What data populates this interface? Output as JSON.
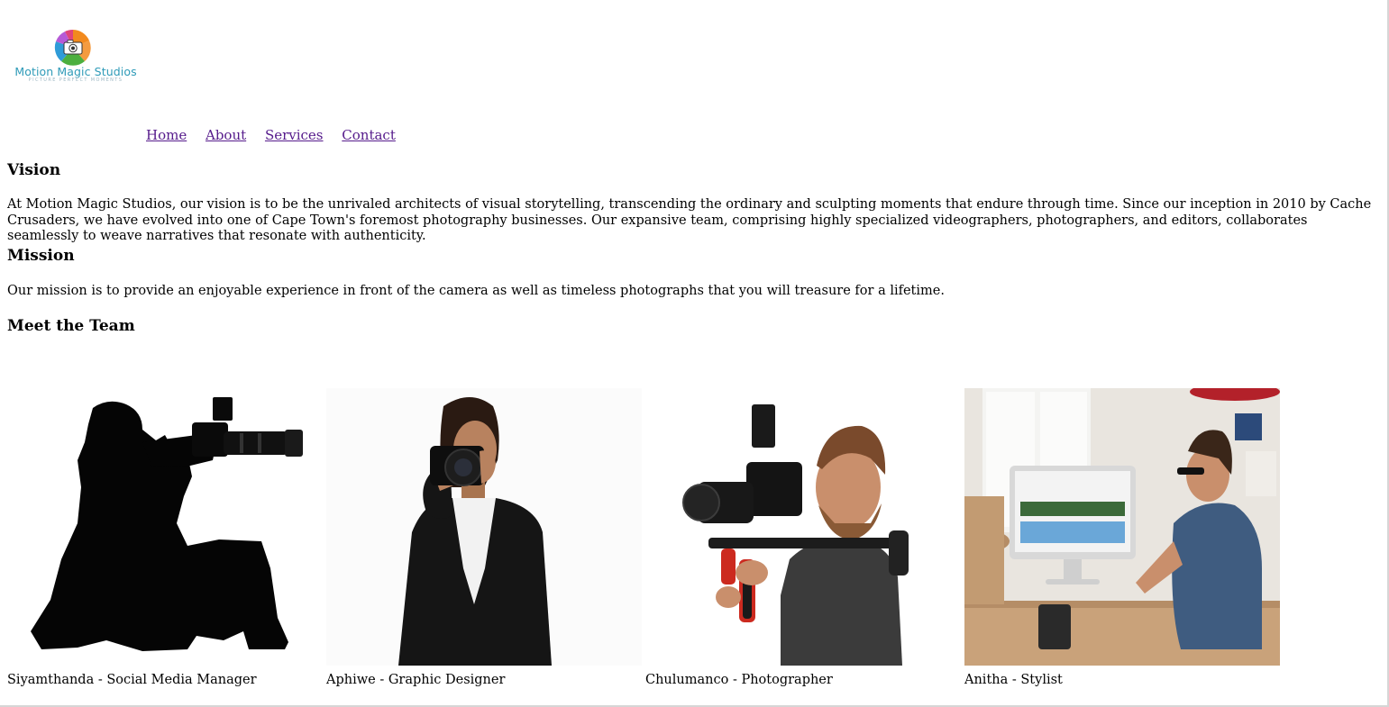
{
  "brand": {
    "name": "Motion Magic Studios",
    "tagline": "PICTURE PERFECT MOMENTS",
    "colors": {
      "name_text": "#2f9bb8",
      "tagline_text": "#9fb8c4",
      "petal_purple": "#b65ad6",
      "petal_orange": "#f28a1e",
      "petal_green": "#4caf3f",
      "petal_blue": "#2f9bd8",
      "petal_pink": "#e0457b"
    },
    "icon": "camera-shutter-logo-icon"
  },
  "nav": {
    "items": [
      {
        "label": "Home"
      },
      {
        "label": "About"
      },
      {
        "label": "Services"
      },
      {
        "label": "Contact"
      }
    ],
    "link_color": "#551a8b"
  },
  "vision": {
    "heading": "Vision",
    "body": "At Motion Magic Studios, our vision is to be the unrivaled architects of visual storytelling, transcending the ordinary and sculpting moments that endure through time. Since our inception in 2010 by Cache Crusaders, we have evolved into one of Cape Town's foremost photography businesses. Our expansive team, comprising highly specialized videographers, photographers, and editors, collaborates seamlessly to weave narratives that resonate with authenticity."
  },
  "mission": {
    "heading": "Mission",
    "body": "Our mission is to provide an enjoyable experience in front of the camera as well as timeless photographs that you will treasure for a lifetime."
  },
  "team": {
    "heading": "Meet the Team",
    "members": [
      {
        "caption": "Siyamthanda - Social Media Manager",
        "photo": "photographer-silhouette-photo"
      },
      {
        "caption": "Aphiwe - Graphic Designer",
        "photo": "woman-with-camera-photo"
      },
      {
        "caption": "Chulumanco - Photographer",
        "photo": "man-with-video-rig-photo"
      },
      {
        "caption": "Anitha - Stylist",
        "photo": "woman-at-computer-photo"
      }
    ]
  }
}
